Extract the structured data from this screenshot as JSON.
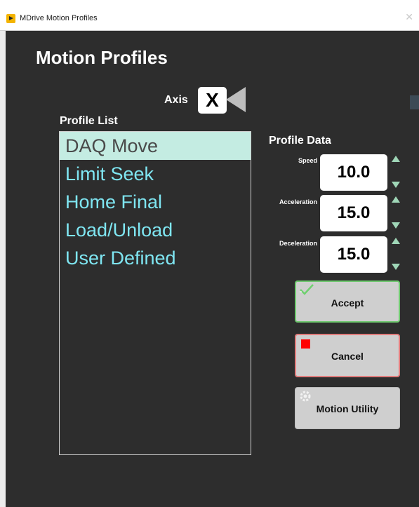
{
  "window": {
    "title": "MDrive Motion Profiles",
    "close_glyph": "✕"
  },
  "header": {
    "title": "Motion Profiles"
  },
  "axis": {
    "label": "Axis",
    "value": "X"
  },
  "profile_list": {
    "label": "Profile List",
    "items": [
      "DAQ Move",
      "Limit Seek",
      "Home Final",
      "Load/Unload",
      "User Defined"
    ],
    "selected": "DAQ Move"
  },
  "profile_data": {
    "label": "Profile Data",
    "speed": {
      "label": "Speed",
      "value": "10.0"
    },
    "acceleration": {
      "label": "Acceleration",
      "value": "15.0"
    },
    "deceleration": {
      "label": "Deceleration",
      "value": "15.0"
    }
  },
  "buttons": {
    "accept": {
      "label": "Accept",
      "icon": "check-icon"
    },
    "cancel": {
      "label": "Cancel",
      "icon": "stop-icon"
    },
    "motion_utility": {
      "label": "Motion Utility",
      "icon": "gear-icon"
    }
  },
  "colors": {
    "background": "#2d2d2d",
    "list_text": "#7fe6f2",
    "selected_row": "#c4ece2",
    "accept_border": "#6fc86f",
    "cancel_border": "#e07c7c",
    "spinner": "#9fd6b7"
  }
}
